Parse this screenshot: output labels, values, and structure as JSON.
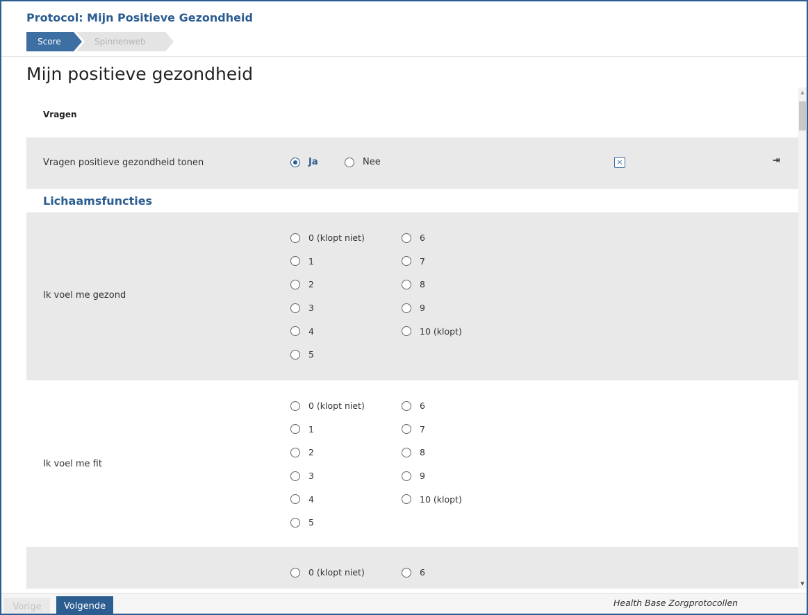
{
  "header": {
    "protocol_title": "Protocol: Mijn Positieve Gezondheid",
    "steps": [
      {
        "label": "Score",
        "active": true
      },
      {
        "label": "Spinnenweb",
        "active": false
      }
    ]
  },
  "page_title": "Mijn positieve gezondheid",
  "section": {
    "title": "Vragen"
  },
  "toggle_question": {
    "label": "Vragen positieve gezondheid tonen",
    "options": [
      {
        "label": "Ja",
        "selected": true
      },
      {
        "label": "Nee",
        "selected": false
      }
    ],
    "clear_icon": "close-square-icon",
    "clear_glyph": "×",
    "exit_icon": "sign-out-icon",
    "exit_glyph": "⇥"
  },
  "category": {
    "title": "Lichaamsfuncties"
  },
  "questions": [
    {
      "label": "Ik voel me gezond",
      "options": [
        "0 (klopt niet)",
        "1",
        "2",
        "3",
        "4",
        "5",
        "6",
        "7",
        "8",
        "9",
        "10 (klopt)"
      ]
    },
    {
      "label": "Ik voel me fit",
      "options": [
        "0 (klopt niet)",
        "1",
        "2",
        "3",
        "4",
        "5",
        "6",
        "7",
        "8",
        "9",
        "10 (klopt)"
      ]
    },
    {
      "label": "",
      "options": [
        "0 (klopt niet)",
        "6"
      ]
    }
  ],
  "scrollbar": {
    "up_glyph": "▲",
    "down_glyph": "▼"
  },
  "footer": {
    "prev_label": "Vorige",
    "next_label": "Volgende",
    "brand": "Health Base Zorgprotocollen"
  },
  "colors": {
    "accent": "#2b5d91",
    "row_gray": "#e9e9e9"
  }
}
